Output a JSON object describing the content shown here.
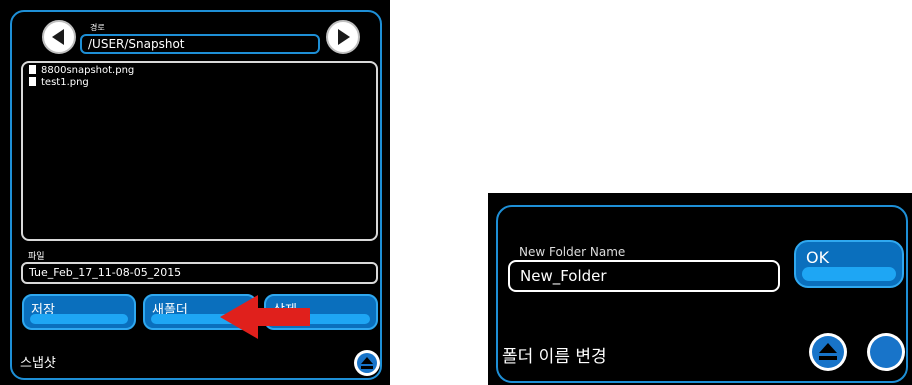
{
  "file_dialog": {
    "path_label": "경로",
    "path_value": "/USER/Snapshot",
    "files": [
      "8800snapshot.png",
      "test1.png"
    ],
    "file_label": "파일",
    "file_value": "Tue_Feb_17_11-08-05_2015",
    "buttons": {
      "save": "저장",
      "new_folder": "새폴더",
      "delete": "삭제"
    },
    "footer_title": "스냅샷"
  },
  "rename_dialog": {
    "name_label": "New Folder Name",
    "name_value": "New_Folder",
    "ok_label": "OK",
    "footer_title": "폴더 이름 변경"
  },
  "colors": {
    "panel_bg": "#000000",
    "frame_border": "#1e8fd6",
    "button_fill": "#0a6fbd",
    "button_glow": "#1ea6f4",
    "pointer_arrow": "#e0201c"
  },
  "icons": [
    "back-arrow-icon",
    "forward-arrow-icon",
    "file-icon",
    "home-icon",
    "red-pointer-arrow"
  ]
}
